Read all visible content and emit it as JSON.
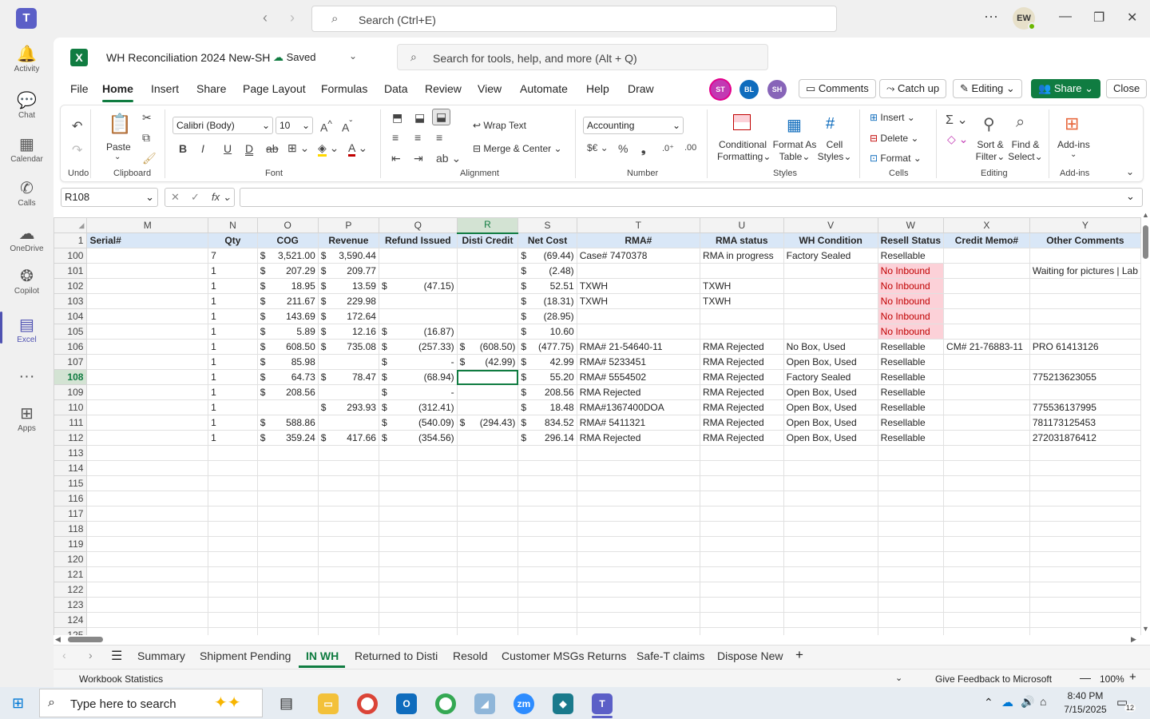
{
  "teams": {
    "search_placeholder": "Search (Ctrl+E)",
    "avatar_initials": "EW",
    "rail": [
      {
        "label": "Activity",
        "icon": "bell-icon",
        "glyph": "🔔"
      },
      {
        "label": "Chat",
        "icon": "chat-icon",
        "glyph": "💬"
      },
      {
        "label": "Calendar",
        "icon": "calendar-icon",
        "glyph": "▦"
      },
      {
        "label": "Calls",
        "icon": "phone-icon",
        "glyph": "✆"
      },
      {
        "label": "OneDrive",
        "icon": "cloud-icon",
        "glyph": "☁"
      },
      {
        "label": "Copilot",
        "icon": "copilot-icon",
        "glyph": "❂"
      },
      {
        "label": "Excel",
        "icon": "excel-icon",
        "glyph": "▤"
      },
      {
        "label": "",
        "icon": "more-icon",
        "glyph": "···"
      },
      {
        "label": "Apps",
        "icon": "apps-icon",
        "glyph": "⊞"
      }
    ]
  },
  "excel": {
    "workbook_title": "WH Reconciliation 2024 New-SH",
    "save_status": "Saved",
    "tools_search_placeholder": "Search for tools, help, and more (Alt + Q)",
    "menu_tabs": [
      "File",
      "Home",
      "Insert",
      "Share",
      "Page Layout",
      "Formulas",
      "Data",
      "Review",
      "View",
      "Automate",
      "Help",
      "Draw"
    ],
    "presence": [
      {
        "initials": "ST",
        "color": "#c239b3"
      },
      {
        "initials": "BL",
        "color": "#0f6cbd"
      },
      {
        "initials": "SH",
        "color": "#8764b8"
      }
    ],
    "buttons": {
      "comments": "Comments",
      "catch_up": "Catch up",
      "editing": "Editing",
      "share": "Share",
      "close": "Close"
    },
    "ribbon": {
      "undo_label": "Undo",
      "paste_label": "Paste",
      "clipboard_label": "Clipboard",
      "font_name": "Calibri (Body)",
      "font_size": "10",
      "font_label": "Font",
      "wrap_text": "Wrap Text",
      "merge_center": "Merge & Center",
      "alignment_label": "Alignment",
      "number_format": "Accounting",
      "number_label": "Number",
      "conditional_1": "Conditional",
      "conditional_2": "Formatting",
      "format_as_1": "Format As",
      "format_as_2": "Table",
      "cell_styles_1": "Cell",
      "cell_styles_2": "Styles",
      "styles_label": "Styles",
      "insert": "Insert",
      "delete": "Delete",
      "format": "Format",
      "cells_label": "Cells",
      "sort_1": "Sort &",
      "sort_2": "Filter",
      "find_1": "Find &",
      "find_2": "Select",
      "editing_label": "Editing",
      "addins": "Add-ins",
      "addins_label": "Add-ins"
    },
    "name_box": "R108",
    "columns": [
      "M",
      "N",
      "O",
      "P",
      "Q",
      "R",
      "S",
      "T",
      "U",
      "V",
      "W",
      "X",
      "Y"
    ],
    "header_row_number": "1",
    "headers": [
      "Serial#",
      "Qty",
      "COG",
      "Revenue",
      "Refund Issued",
      "Disti Credit",
      "Net Cost",
      "RMA#",
      "RMA status",
      "WH Condition",
      "Resell Status",
      "Credit Memo#",
      "Other Comments"
    ],
    "rows": [
      {
        "n": "100",
        "cells": [
          "",
          "7",
          "3,521.00",
          "3,590.44",
          "",
          "",
          "(69.44)",
          "Case# 7470378",
          "RMA in progress",
          "Factory Sealed",
          "Resellable",
          "",
          ""
        ]
      },
      {
        "n": "101",
        "cells": [
          "",
          "1",
          "207.29",
          "209.77",
          "",
          "",
          "(2.48)",
          "",
          "",
          "",
          "No Inbound",
          "",
          "Waiting for pictures | Lab"
        ]
      },
      {
        "n": "102",
        "cells": [
          "",
          "1",
          "18.95",
          "13.59",
          "(47.15)",
          "",
          "52.51",
          "TXWH",
          "TXWH",
          "",
          "No Inbound",
          "",
          ""
        ]
      },
      {
        "n": "103",
        "cells": [
          "",
          "1",
          "211.67",
          "229.98",
          "",
          "",
          "(18.31)",
          "TXWH",
          "TXWH",
          "",
          "No Inbound",
          "",
          ""
        ]
      },
      {
        "n": "104",
        "cells": [
          "",
          "1",
          "143.69",
          "172.64",
          "",
          "",
          "(28.95)",
          "",
          "",
          "",
          "No Inbound",
          "",
          ""
        ]
      },
      {
        "n": "105",
        "cells": [
          "",
          "1",
          "5.89",
          "12.16",
          "(16.87)",
          "",
          "10.60",
          "",
          "",
          "",
          "No Inbound",
          "",
          ""
        ]
      },
      {
        "n": "106",
        "cells": [
          "",
          "1",
          "608.50",
          "735.08",
          "(257.33)",
          "(608.50)",
          "(477.75)",
          "RMA# 21-54640-11",
          "RMA Rejected",
          "No Box, Used",
          "Resellable",
          "CM# 21-76883-11",
          "PRO 61413126"
        ]
      },
      {
        "n": "107",
        "cells": [
          "",
          "1",
          "85.98",
          "",
          "-",
          "(42.99)",
          "42.99",
          "RMA# 5233451",
          "RMA Rejected",
          "Open Box, Used",
          "Resellable",
          "",
          ""
        ]
      },
      {
        "n": "108",
        "cells": [
          "",
          "1",
          "64.73",
          "78.47",
          "(68.94)",
          "",
          "55.20",
          "RMA# 5554502",
          "RMA Rejected",
          "Factory Sealed",
          "Resellable",
          "",
          "775213623055"
        ]
      },
      {
        "n": "109",
        "cells": [
          "",
          "1",
          "208.56",
          "",
          "-",
          "",
          "208.56",
          "RMA Rejected",
          "RMA Rejected",
          "Open Box, Used",
          "Resellable",
          "",
          ""
        ]
      },
      {
        "n": "110",
        "cells": [
          "",
          "1",
          "",
          "293.93",
          "(312.41)",
          "",
          "18.48",
          "RMA#1367400DOA",
          "RMA Rejected",
          "Open Box, Used",
          "Resellable",
          "",
          "775536137995"
        ]
      },
      {
        "n": "111",
        "cells": [
          "",
          "1",
          "588.86",
          "",
          "(540.09)",
          "(294.43)",
          "834.52",
          "RMA# 5411321",
          "RMA Rejected",
          "Open Box, Used",
          "Resellable",
          "",
          "781173125453"
        ]
      },
      {
        "n": "112",
        "cells": [
          "",
          "1",
          "359.24",
          "417.66",
          "(354.56)",
          "",
          "296.14",
          "RMA Rejected",
          "RMA Rejected",
          "Open Box, Used",
          "Resellable",
          "",
          "272031876412"
        ]
      }
    ],
    "empty_rows": [
      "113",
      "114",
      "115",
      "116",
      "117",
      "118",
      "119",
      "120",
      "121",
      "122",
      "123",
      "124",
      "125"
    ],
    "sheet_tabs": [
      "Summary",
      "Shipment Pending",
      "IN WH",
      "Returned to Disti",
      "Resold",
      "Customer MSGs Returns",
      "Safe-T claims",
      "Dispose New"
    ],
    "active_sheet": "IN WH",
    "status": {
      "left": "Workbook Statistics",
      "feedback": "Give Feedback to Microsoft",
      "zoom": "100%"
    }
  },
  "taskbar": {
    "search_placeholder": "Type here to search",
    "time": "8:40 PM",
    "date": "7/15/2025",
    "notification_count": "12"
  },
  "colors": {
    "excel_green": "#107c41",
    "teams_purple": "#5b5fc7",
    "no_inbound_fill": "#fcd1d8",
    "header_fill": "#d9e7f7"
  }
}
